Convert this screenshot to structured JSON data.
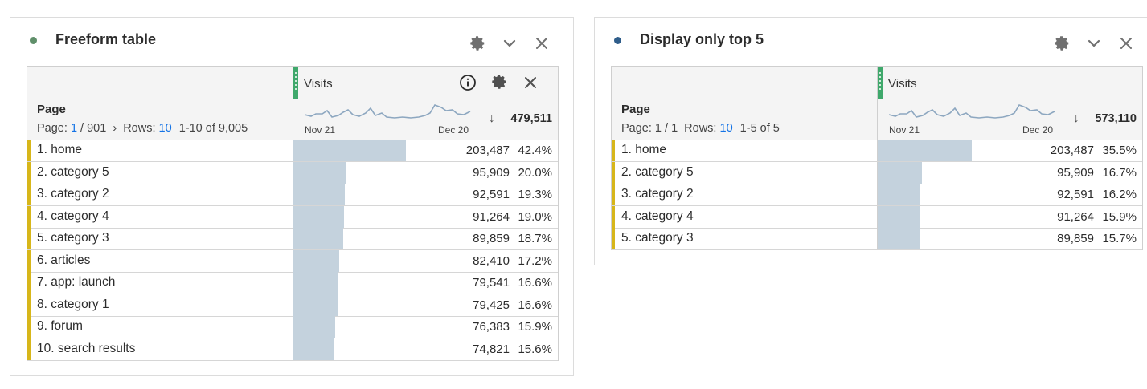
{
  "panels": [
    {
      "title": "Freeform table",
      "dot_color": "#5f8f6a",
      "column_header": "Visits",
      "dimension_label": "Page",
      "pager": {
        "prefix": "Page:",
        "page": "1",
        "of": "/ 901",
        "chevron": "›",
        "rows_label": "Rows:",
        "rows": "10",
        "range": "1-10 of 9,005"
      },
      "date_start": "Nov 21",
      "date_end": "Dec 20",
      "total": "479,511",
      "rows": [
        {
          "label": "1.  home",
          "value": "203,487",
          "pct": "42.4%",
          "fill": 0.424
        },
        {
          "label": "2.  category 5",
          "value": "95,909",
          "pct": "20.0%",
          "fill": 0.2
        },
        {
          "label": "3.  category 2",
          "value": "92,591",
          "pct": "19.3%",
          "fill": 0.193
        },
        {
          "label": "4.  category 4",
          "value": "91,264",
          "pct": "19.0%",
          "fill": 0.19
        },
        {
          "label": "5.  category 3",
          "value": "89,859",
          "pct": "18.7%",
          "fill": 0.187
        },
        {
          "label": "6.  articles",
          "value": "82,410",
          "pct": "17.2%",
          "fill": 0.172
        },
        {
          "label": "7.  app: launch",
          "value": "79,541",
          "pct": "16.6%",
          "fill": 0.166
        },
        {
          "label": "8.  category 1",
          "value": "79,425",
          "pct": "16.6%",
          "fill": 0.166
        },
        {
          "label": "9.  forum",
          "value": "76,383",
          "pct": "15.9%",
          "fill": 0.159
        },
        {
          "label": "10.  search results",
          "value": "74,821",
          "pct": "15.6%",
          "fill": 0.156
        }
      ]
    },
    {
      "title": "Display only top 5",
      "dot_color": "#2f5d8a",
      "column_header": "Visits",
      "dimension_label": "Page",
      "pager": {
        "prefix": "Page: 1 / 1",
        "rows_label": "Rows:",
        "rows": "10",
        "range": "1-5 of 5"
      },
      "date_start": "Nov 21",
      "date_end": "Dec 20",
      "total": "573,110",
      "rows": [
        {
          "label": "1.  home",
          "value": "203,487",
          "pct": "35.5%",
          "fill": 0.355
        },
        {
          "label": "2.  category 5",
          "value": "95,909",
          "pct": "16.7%",
          "fill": 0.167
        },
        {
          "label": "3.  category 2",
          "value": "92,591",
          "pct": "16.2%",
          "fill": 0.162
        },
        {
          "label": "4.  category 4",
          "value": "91,264",
          "pct": "15.9%",
          "fill": 0.159
        },
        {
          "label": "5.  category 3",
          "value": "89,859",
          "pct": "15.7%",
          "fill": 0.157
        }
      ]
    }
  ],
  "icons": {
    "panel": [
      "gear-icon",
      "chevron-down-icon",
      "close-icon"
    ],
    "column": [
      "info-icon",
      "gear-icon",
      "close-icon"
    ],
    "sort": "sort-descending-arrow-icon"
  },
  "colors": {
    "bar": "#c4d2dd",
    "row_marker": "#d7b61a",
    "column_grip": "#3fa86b",
    "link": "#1473e6"
  }
}
